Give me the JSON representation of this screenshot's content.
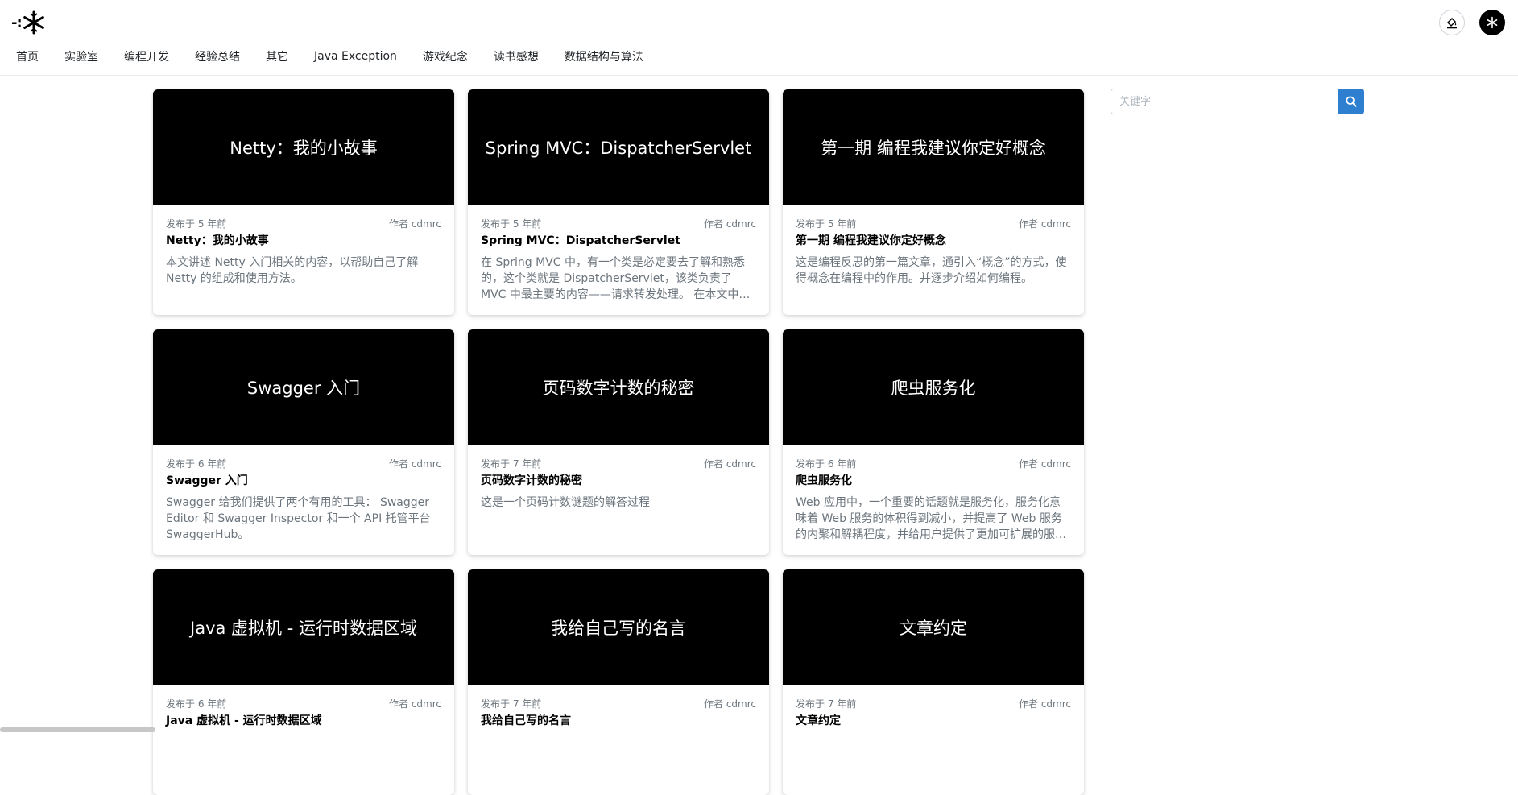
{
  "nav": {
    "items": [
      "首页",
      "实验室",
      "编程开发",
      "经验总结",
      "其它",
      "Java Exception",
      "游戏纪念",
      "读书感想",
      "数据结构与算法"
    ]
  },
  "search": {
    "placeholder": "关键字"
  },
  "icons": {
    "logo": "snowflake-logo-icon",
    "theme": "paint-bucket-icon",
    "search": "magnifier-icon"
  },
  "colors": {
    "accent": "#2f7fd1",
    "banner": "#000000"
  },
  "posts": [
    {
      "banner": "Netty：我的小故事",
      "published": "发布于 5 年前",
      "author": "作者 cdmrc",
      "title": "Netty：我的小故事",
      "summary": "本文讲述 Netty 入门相关的内容，以帮助自己了解 Netty 的组成和使用方法。"
    },
    {
      "banner": "Spring MVC：DispatcherServlet",
      "published": "发布于 5 年前",
      "author": "作者 cdmrc",
      "title": "Spring MVC：DispatcherServlet",
      "summary": "在 Spring MVC 中，有一个类是必定要去了解和熟悉的，这个类就是 DispatcherServlet，该类负责了 MVC 中最主要的内容——请求转发处理。 在本文中，我们…"
    },
    {
      "banner": "第一期 编程我建议你定好概念",
      "published": "发布于 5 年前",
      "author": "作者 cdmrc",
      "title": "第一期 编程我建议你定好概念",
      "summary": "这是编程反思的第一篇文章，通引入“概念”的方式，使得概念在编程中的作用。并逐步介绍如何编程。"
    },
    {
      "banner": "Swagger 入门",
      "published": "发布于 6 年前",
      "author": "作者 cdmrc",
      "title": "Swagger 入门",
      "summary": "Swagger 给我们提供了两个有用的工具： Swagger Editor 和 Swagger Inspector 和一个 API 托管平台 SwaggerHub。"
    },
    {
      "banner": "页码数字计数的秘密",
      "published": "发布于 7 年前",
      "author": "作者 cdmrc",
      "title": "页码数字计数的秘密",
      "summary": "这是一个页码计数谜题的解答过程"
    },
    {
      "banner": "爬虫服务化",
      "published": "发布于 6 年前",
      "author": "作者 cdmrc",
      "title": "爬虫服务化",
      "summary": "Web 应用中，一个重要的话题就是服务化，服务化意味着 Web 服务的体积得到减小，并提高了 Web 服务的内聚和解耦程度，并给用户提供了更加可扩展的服…"
    },
    {
      "banner": "Java 虚拟机 - 运行时数据区域",
      "published": "发布于 6 年前",
      "author": "作者 cdmrc",
      "title": "Java 虚拟机 - 运行时数据区域",
      "summary": ""
    },
    {
      "banner": "我给自己写的名言",
      "published": "发布于 7 年前",
      "author": "作者 cdmrc",
      "title": "我给自己写的名言",
      "summary": ""
    },
    {
      "banner": "文章约定",
      "published": "发布于 7 年前",
      "author": "作者 cdmrc",
      "title": "文章约定",
      "summary": ""
    }
  ]
}
